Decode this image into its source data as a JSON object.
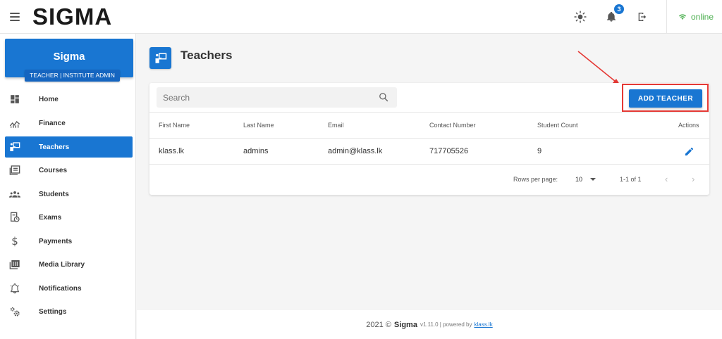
{
  "topbar": {
    "brand": "SIGMA",
    "notification_count": "3",
    "status": "online",
    "icons": [
      "menu-icon",
      "theme-sun-icon",
      "bell-icon",
      "logout-icon",
      "wifi-icon"
    ]
  },
  "sidebar": {
    "card": {
      "name": "Sigma",
      "role": "TEACHER | INSTITUTE ADMIN"
    },
    "items": [
      {
        "label": "Home",
        "icon": "dashboard-icon"
      },
      {
        "label": "Finance",
        "icon": "chart-icon"
      },
      {
        "label": "Teachers",
        "icon": "teacher-icon",
        "active": true
      },
      {
        "label": "Courses",
        "icon": "courses-icon"
      },
      {
        "label": "Students",
        "icon": "students-icon"
      },
      {
        "label": "Exams",
        "icon": "exams-icon"
      },
      {
        "label": "Payments",
        "icon": "dollar-icon"
      },
      {
        "label": "Media Library",
        "icon": "media-library-icon"
      },
      {
        "label": "Notifications",
        "icon": "bell-outline-icon"
      },
      {
        "label": "Settings",
        "icon": "settings-gears-icon"
      }
    ]
  },
  "main": {
    "title": "Teachers",
    "search_placeholder": "Search",
    "add_button": "ADD TEACHER",
    "columns": [
      "First Name",
      "Last Name",
      "Email",
      "Contact Number",
      "Student Count",
      "Actions"
    ],
    "rows": [
      {
        "first_name": "klass.lk",
        "last_name": "admins",
        "email": "admin@klass.lk",
        "contact": "717705526",
        "student_count": "9"
      }
    ],
    "pagination": {
      "rows_per_page_label": "Rows per page:",
      "rows_per_page": "10",
      "range": "1-1 of 1"
    }
  },
  "footer": {
    "year": "2021 ©",
    "brand": "Sigma",
    "version": "v1.11.0 | powered by",
    "link": "klass.lk"
  },
  "colors": {
    "primary": "#1976d2",
    "online": "#4caf50",
    "highlight": "#e53935"
  }
}
